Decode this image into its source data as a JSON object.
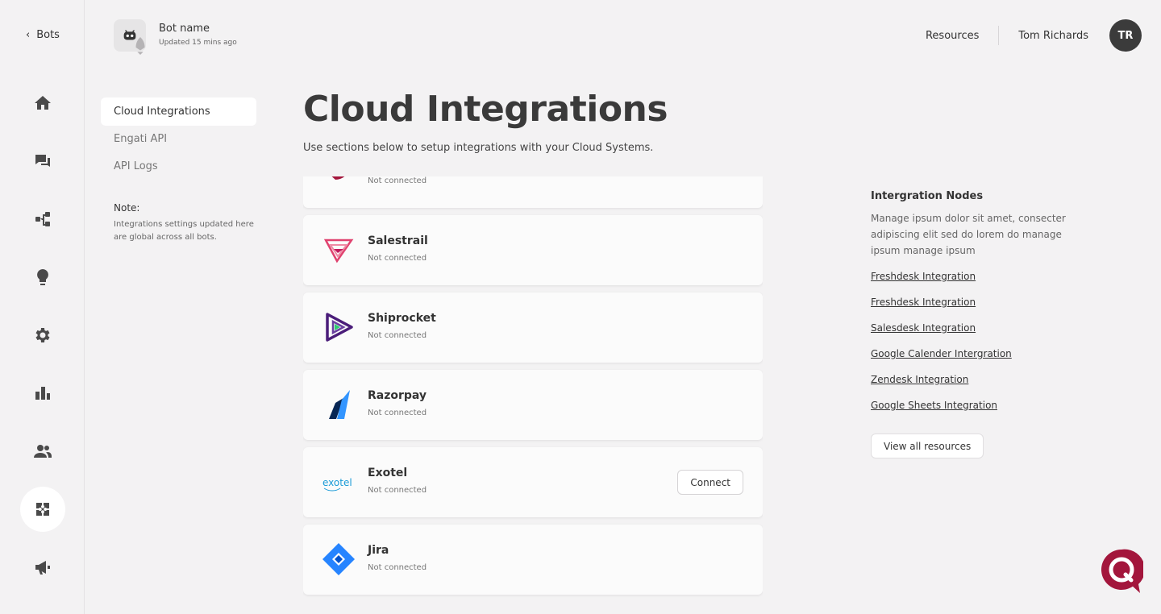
{
  "nav": {
    "back_label": "Bots",
    "rail_icons": [
      "home-icon",
      "chat-icon",
      "flow-icon",
      "bulb-icon",
      "gear-icon",
      "bar-chart-icon",
      "users-icon",
      "integrations-icon",
      "megaphone-icon"
    ]
  },
  "bot": {
    "name": "Bot name",
    "updated": "Updated 15 mins ago"
  },
  "header": {
    "resources_label": "Resources",
    "user_name": "Tom Richards",
    "user_initials": "TR"
  },
  "subnav": {
    "items": [
      {
        "label": "Cloud Integrations",
        "active": true
      },
      {
        "label": "Engati API",
        "active": false
      },
      {
        "label": "API Logs",
        "active": false
      }
    ],
    "note_title": "Note:",
    "note_text": "Integrations settings updated here are global across all bots."
  },
  "main": {
    "title": "Cloud Integrations",
    "subtitle": "Use sections below to setup integrations with your Cloud Systems."
  },
  "integrations": [
    {
      "name": "",
      "status": "Not connected",
      "logo": "red-partial-logo"
    },
    {
      "name": "Salestrail",
      "status": "Not connected",
      "logo": "salestrail-logo"
    },
    {
      "name": "Shiprocket",
      "status": "Not connected",
      "logo": "shiprocket-logo"
    },
    {
      "name": "Razorpay",
      "status": "Not connected",
      "logo": "razorpay-logo"
    },
    {
      "name": "Exotel",
      "status": "Not connected",
      "logo": "exotel-logo",
      "action": "Connect"
    },
    {
      "name": "Jira",
      "status": "Not connected",
      "logo": "jira-logo"
    }
  ],
  "resources_panel": {
    "title": "Intergration Nodes",
    "description": "Manage ipsum dolor sit amet, consecter adipiscing elit sed do lorem do manage ipsum manage ipsum",
    "links": [
      "Freshdesk Integration",
      "Freshdesk Integration",
      "Salesdesk Integration",
      "Google Calender Intergration",
      "Zendesk Integration",
      "Google Sheets Integration"
    ],
    "button_label": "View all resources"
  },
  "colors": {
    "accent": "#a3163c",
    "background": "#f3f2f3",
    "card": "#fbfbfb",
    "text": "#333333"
  }
}
